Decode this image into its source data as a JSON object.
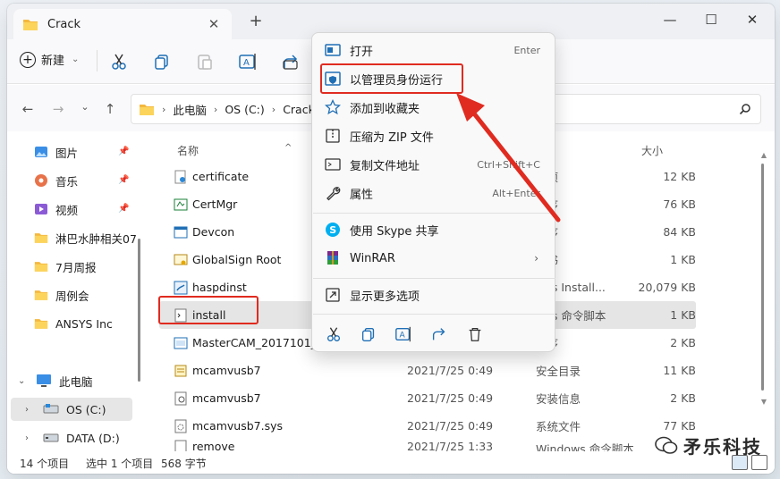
{
  "window": {
    "tab_title": "Crack",
    "close_tab": "✕",
    "new_tab": "+",
    "minimize": "—",
    "maximize": "☐",
    "close": "✕"
  },
  "toolbar": {
    "new_label": "新建",
    "new_chevron": "⌄"
  },
  "address": {
    "crumbs": [
      "此电脑",
      "OS (C:)",
      "Crack"
    ],
    "separator": "›"
  },
  "sidebar": {
    "items": [
      {
        "label": "图片",
        "icon": "pictures-icon",
        "pinned": true
      },
      {
        "label": "音乐",
        "icon": "music-icon",
        "pinned": true
      },
      {
        "label": "视频",
        "icon": "video-icon",
        "pinned": true
      },
      {
        "label": "淋巴水肿相关07",
        "icon": "folder-icon",
        "pinned": false
      },
      {
        "label": "7月周报",
        "icon": "folder-icon",
        "pinned": false
      },
      {
        "label": "周例会",
        "icon": "folder-icon",
        "pinned": false
      },
      {
        "label": "ANSYS Inc",
        "icon": "folder-icon",
        "pinned": false
      },
      {
        "label": "此电脑",
        "icon": "pc-icon",
        "pinned": false
      },
      {
        "label": "OS (C:)",
        "icon": "drive-icon",
        "pinned": false
      },
      {
        "label": "DATA (D:)",
        "icon": "drive-icon",
        "pinned": false
      }
    ]
  },
  "columns": {
    "name": "名称",
    "size": "大小"
  },
  "files": [
    {
      "name": "certificate",
      "date": "",
      "type": "装项",
      "size": "12 KB",
      "icon": "certificate-icon"
    },
    {
      "name": "CertMgr",
      "date": "",
      "type": "程序",
      "size": "76 KB",
      "icon": "app-icon"
    },
    {
      "name": "Devcon",
      "date": "",
      "type": "程序",
      "size": "84 KB",
      "icon": "app-icon"
    },
    {
      "name": "GlobalSign Root",
      "date": "",
      "type": "正书",
      "size": "1 KB",
      "icon": "cert-file-icon"
    },
    {
      "name": "haspdinst",
      "date": "",
      "type": "ows Install...",
      "size": "20,079 KB",
      "icon": "installer-icon"
    },
    {
      "name": "install",
      "date": "",
      "type": "ows 命令脚本",
      "size": "1 KB",
      "icon": "script-icon"
    },
    {
      "name": "MasterCAM_2017101_ha",
      "date": "",
      "type": "程序",
      "size": "2 KB",
      "icon": "app-icon"
    },
    {
      "name": "mcamvusb7",
      "date": "2021/7/25 0:49",
      "type": "安全目录",
      "size": "11 KB",
      "icon": "catalog-icon"
    },
    {
      "name": "mcamvusb7",
      "date": "2021/7/25 0:49",
      "type": "安装信息",
      "size": "2 KB",
      "icon": "inf-icon"
    },
    {
      "name": "mcamvusb7.sys",
      "date": "2021/7/25 0:49",
      "type": "系统文件",
      "size": "77 KB",
      "icon": "sys-file-icon"
    },
    {
      "name": "remove",
      "date": "2021/7/25 1:33",
      "type": "Windows 命令脚本",
      "size": "",
      "icon": "script-icon"
    }
  ],
  "status": {
    "count": "14 个项目",
    "selection": "选中 1 个项目",
    "size": "568 字节"
  },
  "context_menu": {
    "items": [
      {
        "label": "打开",
        "shortcut": "Enter",
        "icon": "open-icon"
      },
      {
        "label": "以管理员身份运行",
        "shortcut": "",
        "icon": "admin-shield-icon"
      },
      {
        "label": "添加到收藏夹",
        "shortcut": "",
        "icon": "star-icon"
      },
      {
        "label": "压缩为 ZIP 文件",
        "shortcut": "",
        "icon": "zip-icon"
      },
      {
        "label": "复制文件地址",
        "shortcut": "Ctrl+Shift+C",
        "icon": "copy-path-icon"
      },
      {
        "label": "属性",
        "shortcut": "Alt+Enter",
        "icon": "wrench-icon"
      },
      {
        "label": "使用 Skype 共享",
        "shortcut": "",
        "icon": "skype-icon"
      },
      {
        "label": "WinRAR",
        "shortcut": "",
        "icon": "winrar-icon",
        "submenu": "›"
      },
      {
        "label": "显示更多选项",
        "shortcut": "",
        "icon": "more-options-icon"
      }
    ]
  },
  "watermark": {
    "text": "矛乐科技"
  },
  "colors": {
    "highlight": "#e02b20",
    "accent": "#0067c0",
    "folder": "#f7c948"
  }
}
